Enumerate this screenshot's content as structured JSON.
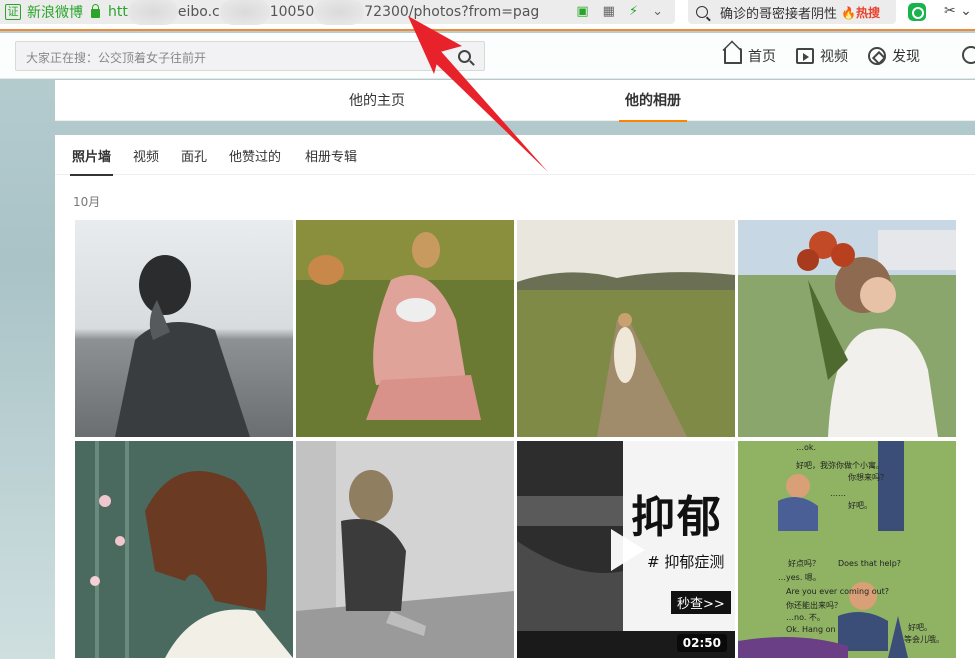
{
  "browser": {
    "cert_label": "证",
    "site_name": "新浪微博",
    "url_prefix": "htt",
    "url_mid1": "eibo.c",
    "url_mid2": "10050",
    "url_mid3": "72300/photos?from=pag",
    "hot_search_term": "确诊的哥密接者阴性",
    "hot_badge": "热搜"
  },
  "nav": {
    "search_placeholder": "大家正在搜：公交顶着女子往前开",
    "items": [
      {
        "label": "首页",
        "icon": "home-icon"
      },
      {
        "label": "视频",
        "icon": "video-icon"
      },
      {
        "label": "发现",
        "icon": "discover-icon"
      }
    ]
  },
  "profile_tabs": [
    {
      "label": "他的主页",
      "active": false
    },
    {
      "label": "他的相册",
      "active": true
    }
  ],
  "album": {
    "subtabs": [
      {
        "label": "照片墙",
        "active": true
      },
      {
        "label": "视频",
        "active": false
      },
      {
        "label": "面孔",
        "active": false
      },
      {
        "label": "他赞过的",
        "active": false
      },
      {
        "label": "相册专辑",
        "active": false
      }
    ],
    "month": "10月",
    "video": {
      "title": "抑郁",
      "tag": "# 抑郁症测",
      "button": "秒查>>",
      "duration": "02:50"
    },
    "comic": {
      "lines": [
        "好吧，我弥你做个小寓。",
        "你想来吗？",
        "……",
        "好吧。",
        "好点吗？",
        "…yes. 嗯。",
        "…no. 不。",
        "Ok. Hang on",
        "好吧。",
        "等会儿哦。",
        "Does that help?",
        "Are you ever coming out?",
        "你还能出来吗？",
        "…to come?",
        "…ok."
      ]
    }
  },
  "colors": {
    "accent_orange": "#ff8200",
    "browser_green": "#2aa52a",
    "arrow_red": "#e8222a",
    "hot_red": "#e8412c"
  }
}
